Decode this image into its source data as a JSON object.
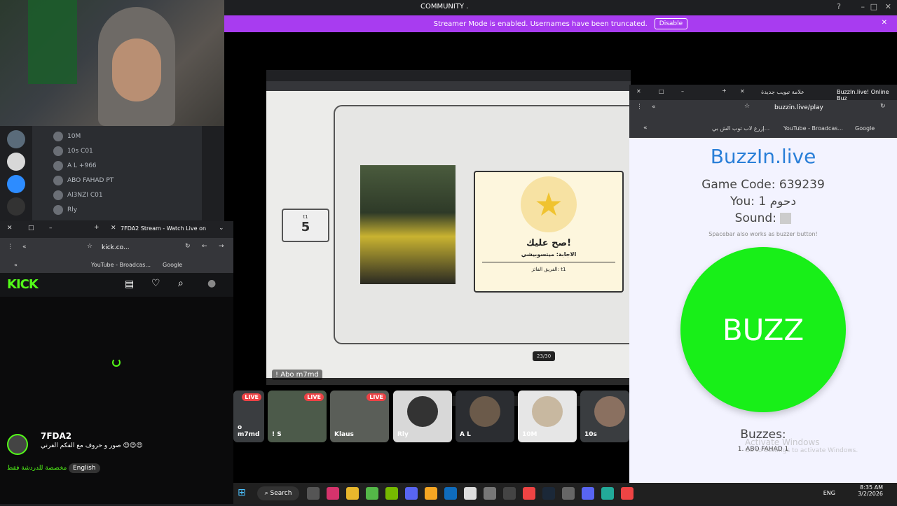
{
  "discord": {
    "community": "COMMUNITY .",
    "banner_text": "Streamer Mode is enabled. Usernames have been truncated.",
    "banner_button": "Disable",
    "share_label": "! Abo m7md"
  },
  "voice_list": [
    {
      "name": "10M",
      "badge": ""
    },
    {
      "name": "10s",
      "badge": "C01"
    },
    {
      "name": "A L",
      "badge": "+966"
    },
    {
      "name": "ABO FAHAD",
      "badge": "PT"
    },
    {
      "name": "Al3NZI",
      "badge": "C01"
    },
    {
      "name": "Rly",
      "badge": ""
    }
  ],
  "game": {
    "counter_label": "t1",
    "counter_value": "5",
    "card_heading": "صح عليك!",
    "card_answer": "الاجابة: ميتسوبيشي",
    "card_winner": "الفريق الفائز: t1",
    "pager": "23/30"
  },
  "buzzin": {
    "tab_new": "علامة تبويب جديدة",
    "tab_active": "BuzzIn.live! Online Buz",
    "url": "buzzin.live/play",
    "bookmark1": "إزرع لاب توب الش بي...",
    "bookmark2": "YouTube - Broadcas...",
    "bookmark3": "Google",
    "logo": "BuzzIn.live",
    "game_code": "Game Code: 639239",
    "you": "You: دحوم 1",
    "sound": "Sound:",
    "hint": "Spacebar also works as buzzer button!",
    "buzz_label": "BUZZ",
    "buzzes_heading": "Buzzes:",
    "buzz_item": "1. ABO FAHAD 1",
    "activate": "Activate Windows",
    "activate_sub": "Go to Settings to activate Windows."
  },
  "kick": {
    "tab_title": "7FDA2 Stream - Watch Live on",
    "url": "kick.co...",
    "bookmark1": "YouTube - Broadcas...",
    "bookmark2": "Google",
    "logo": "KICK",
    "channel": "7FDA2",
    "title": "صور و حروف مع الفكم الفرني 😍😍😍",
    "tag_lang_ar": "مخصصة للدردشة فقط",
    "tag_lang": "English"
  },
  "participants": [
    {
      "label": "o m7md",
      "live": "LIVE"
    },
    {
      "label": "! S",
      "live": "LIVE"
    },
    {
      "label": "Klaus",
      "live": "LIVE"
    },
    {
      "label": "Rly",
      "live": ""
    },
    {
      "label": "A L",
      "live": ""
    },
    {
      "label": "10M",
      "live": ""
    },
    {
      "label": "10s",
      "live": ""
    }
  ],
  "taskbar": {
    "search": "Search",
    "lang": "ENG",
    "time": "8:35 AM",
    "date": "3/2/2026"
  },
  "colors": {
    "banner": "#a83cf0",
    "buzz_green": "#18ef18",
    "kick_green": "#53fc18",
    "live_red": "#ed4245"
  }
}
